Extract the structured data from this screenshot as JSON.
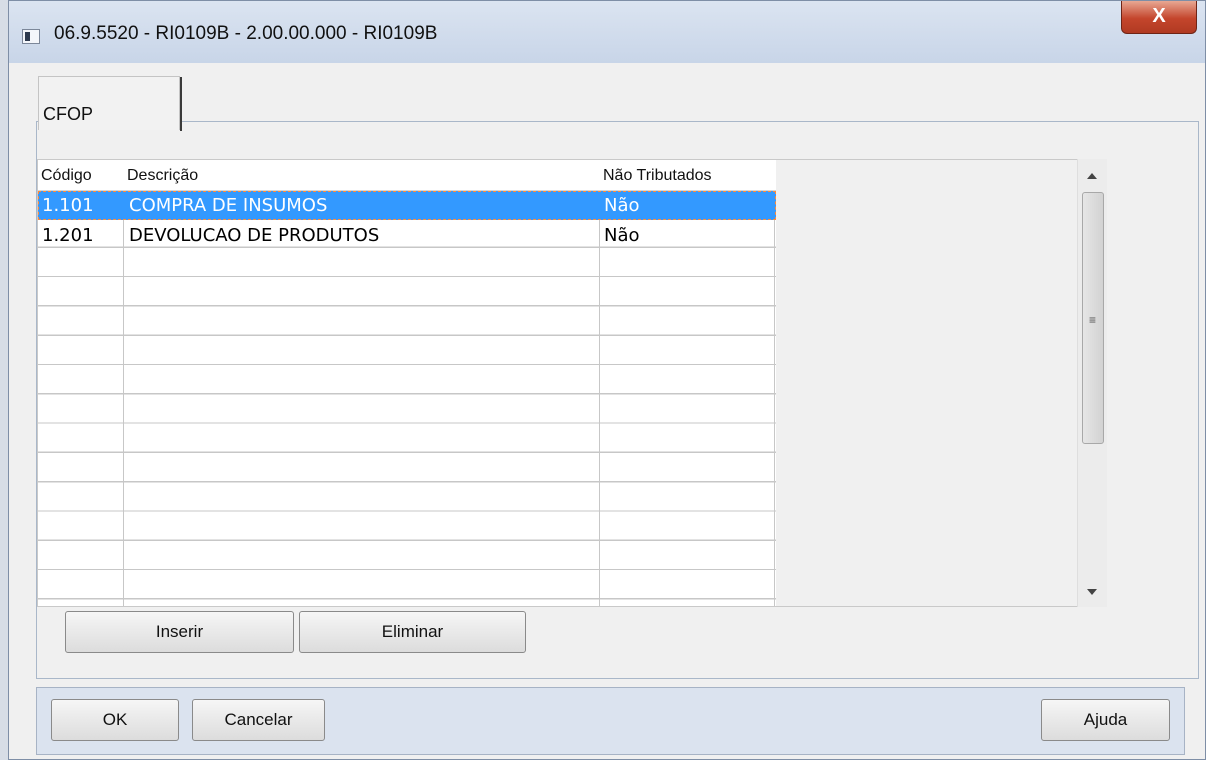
{
  "window": {
    "title": "06.9.5520 - RI0109B - 2.00.00.000 - RI0109B",
    "close_label": "X"
  },
  "tabs": [
    {
      "label": "CFOP"
    }
  ],
  "grid": {
    "columns": [
      "Código",
      "Descrição",
      "Não Tributados"
    ],
    "rows": [
      {
        "codigo": "1.101",
        "descricao": "COMPRA DE INSUMOS",
        "nao_tributados": "Não",
        "selected": true
      },
      {
        "codigo": "1.201",
        "descricao": "DEVOLUCAO DE PRODUTOS",
        "nao_tributados": "Não",
        "selected": false
      }
    ]
  },
  "grid_buttons": {
    "insert": "Inserir",
    "delete": "Eliminar"
  },
  "footer_buttons": {
    "ok": "OK",
    "cancel": "Cancelar",
    "help": "Ajuda"
  },
  "colors": {
    "selection": "#3399ff",
    "titlebar": "#dbe4f1",
    "close": "#c4452c"
  }
}
